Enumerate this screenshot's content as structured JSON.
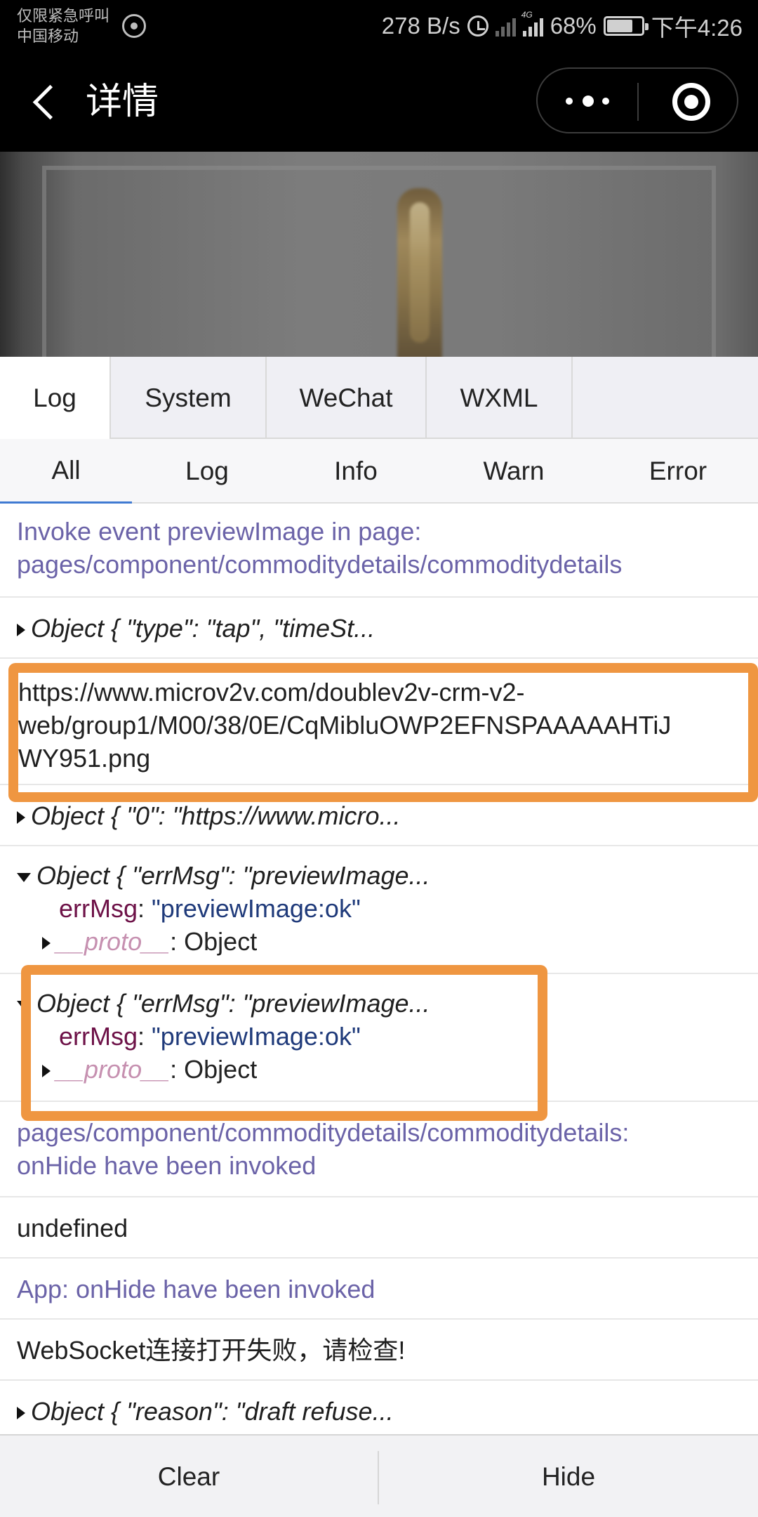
{
  "status_bar": {
    "carrier_line1": "仅限紧急呼叫",
    "carrier_line2": "中国移动",
    "net_speed": "278 B/s",
    "net_type": "4G",
    "battery": "68%",
    "time": "下午4:26"
  },
  "nav": {
    "title": "详情"
  },
  "tabs": [
    "Log",
    "System",
    "WeChat",
    "WXML"
  ],
  "subtabs": [
    "All",
    "Log",
    "Info",
    "Warn",
    "Error"
  ],
  "logs": {
    "r1_line1": "Invoke event previewImage in page:",
    "r1_line2": "pages/component/commoditydetails/commoditydetails",
    "r2": "Object { \"type\": \"tap\", \"timeSt...",
    "r3_line1": "https://www.microv2v.com/doublev2v-crm-v2-",
    "r3_line2": "web/group1/M00/38/0E/CqMibluOWP2EFNSPAAAAAHTiJ",
    "r3_line3": "WY951.png",
    "r4": "Object { \"0\": \"https://www.micro...",
    "r5_head": "Object { \"errMsg\": \"previewImage...",
    "r5_key": "errMsg",
    "r5_val": "\"previewImage:ok\"",
    "r5_proto": "__proto__",
    "r5_proto_val": ": Object",
    "r6_head": "Object { \"errMsg\": \"previewImage...",
    "r6_key": "errMsg",
    "r6_val": "\"previewImage:ok\"",
    "r6_proto": "__proto__",
    "r6_proto_val": ": Object",
    "r7_line1": "pages/component/commoditydetails/commoditydetails:",
    "r7_line2": "onHide have been invoked",
    "r8": "undefined",
    "r9": "App: onHide have been invoked",
    "r10": "WebSocket连接打开失败，请检查!",
    "r11": "Object { \"reason\": \"draft refuse..."
  },
  "footer": {
    "clear": "Clear",
    "hide": "Hide"
  },
  "colors": {
    "highlight": "#ef9641",
    "info_text": "#6b63a8",
    "active_underline": "#3f7ad2"
  }
}
